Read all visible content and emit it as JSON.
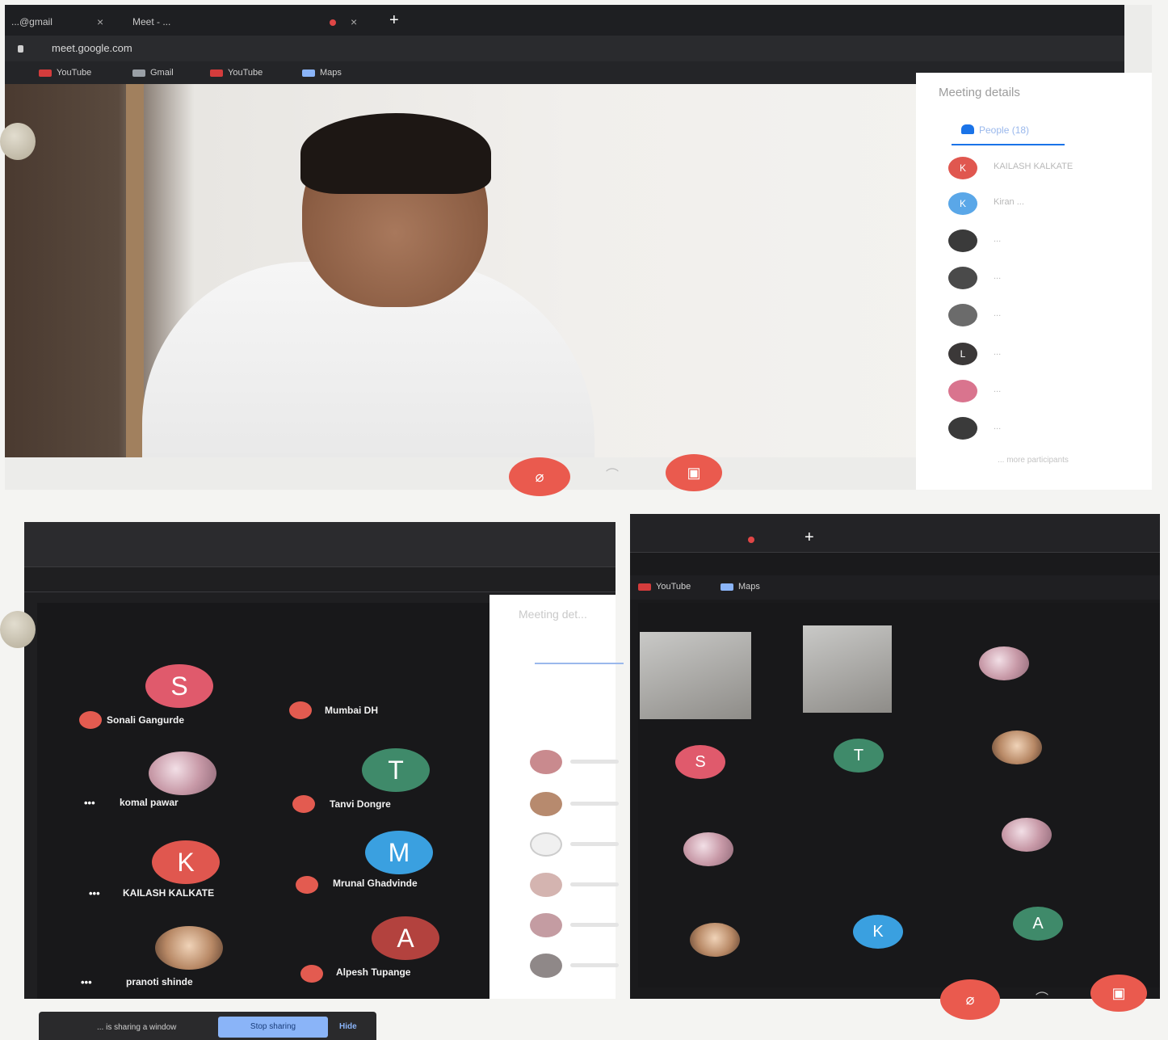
{
  "top_window": {
    "tabs": [
      {
        "label": "...@gmail",
        "close": "×"
      },
      {
        "label": "Meet - ...",
        "close": "×"
      }
    ],
    "new_tab": "+",
    "url": "meet.google.com",
    "bookmarks": [
      "YouTube",
      "Gmail",
      "YouTube",
      "Maps"
    ],
    "panel": {
      "title": "Meeting details",
      "people_tab": "People (18)",
      "participants": [
        {
          "initial": "K",
          "color": "#e0574f",
          "name": "KAILASH KALKATE"
        },
        {
          "initial": "K",
          "color": "#5aa7e8",
          "name": "Kiran ..."
        },
        {
          "initial": "",
          "color": "#3a3a3a",
          "name": "..."
        },
        {
          "initial": "",
          "color": "#4a4a4a",
          "name": "..."
        },
        {
          "initial": "",
          "color": "#6b6b6b",
          "name": "..."
        },
        {
          "initial": "L",
          "color": "#3b3838",
          "name": "..."
        },
        {
          "initial": "",
          "color": "#d9748e",
          "name": "..."
        },
        {
          "initial": "",
          "color": "#3a3a3a",
          "name": "..."
        }
      ],
      "more_text": "... more participants"
    }
  },
  "bottom_left": {
    "tiles": [
      {
        "initial": "S",
        "color": "#e05a6c",
        "name": "Sonali Gangurde",
        "prefix": "",
        "muted": true
      },
      {
        "initial": "",
        "color": "",
        "name": "Mumbai DH",
        "prefix": "",
        "muted": true
      },
      {
        "initial": "",
        "color": "",
        "name": "komal pawar",
        "prefix": "•••",
        "muted": false
      },
      {
        "initial": "T",
        "color": "#3f8a6a",
        "name": "Tanvi Dongre",
        "prefix": "",
        "muted": true
      },
      {
        "initial": "K",
        "color": "#e0574f",
        "name": "KAILASH KALKATE",
        "prefix": "•••",
        "muted": false
      },
      {
        "initial": "M",
        "color": "#3aa0e0",
        "name": "Mrunal Ghadvinde",
        "prefix": "",
        "muted": true
      },
      {
        "initial": "",
        "color": "",
        "name": "pranoti shinde",
        "prefix": "•••",
        "muted": false
      },
      {
        "initial": "A",
        "color": "#b3423e",
        "name": "Alpesh Tupange",
        "prefix": "",
        "muted": true
      }
    ],
    "side_title": "Meeting det..."
  },
  "bottom_right": {
    "bookmarks": [
      "YouTube",
      "Maps"
    ],
    "new_tab": "+",
    "avatars": [
      {
        "initial": "S",
        "color": "#e05a6c"
      },
      {
        "initial": "T",
        "color": "#3f8a6a"
      },
      {
        "initial": "K",
        "color": "#3aa0e0"
      },
      {
        "initial": "A",
        "color": "#3f8a6a"
      }
    ]
  },
  "share_bar": {
    "text": "... is sharing a window",
    "stop_label": "Stop sharing",
    "hide_label": "Hide"
  }
}
